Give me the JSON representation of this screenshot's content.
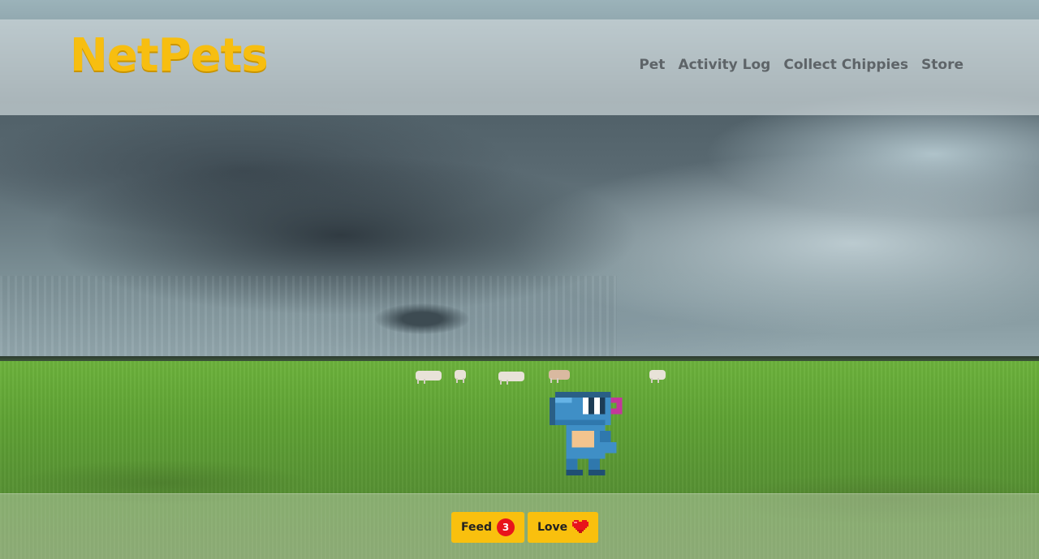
{
  "brand": {
    "name": "NetPets",
    "color": "#f7be10"
  },
  "nav": {
    "items": [
      {
        "label": "Pet"
      },
      {
        "label": "Activity Log"
      },
      {
        "label": "Collect Chippies"
      },
      {
        "label": "Store"
      }
    ]
  },
  "scene": {
    "background": "stormy-sky-grassland-photo",
    "pet": {
      "sprite": "blue-pixel-dinosaur-icon"
    }
  },
  "actions": {
    "feed": {
      "label": "Feed",
      "count": "3"
    },
    "love": {
      "label": "Love",
      "icon": "pixel-heart-icon"
    }
  },
  "colors": {
    "button": "#f9c00e",
    "badge": "#e8141b",
    "nav_text": "#5e6468"
  }
}
